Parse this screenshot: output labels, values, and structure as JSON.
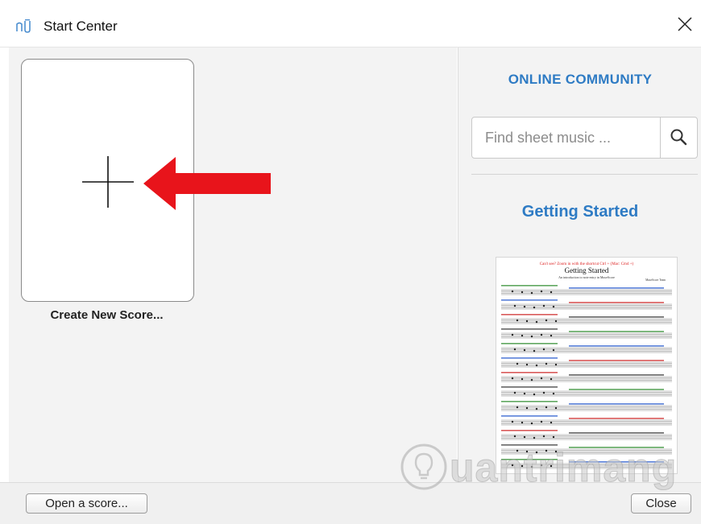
{
  "window": {
    "title": "Start Center"
  },
  "left": {
    "new_score_label": "Create New Score..."
  },
  "right": {
    "community_title": "ONLINE COMMUNITY",
    "search_placeholder": "Find sheet music ...",
    "getting_started_title": "Getting Started",
    "thumbnail": {
      "heading_line": "Can't see? Zoom in with the shortcut Ctrl + (Mac: Cmd +)",
      "title": "Getting Started",
      "subtitle": "An introduction to note entry in MuseScore",
      "author": "MuseScore Team"
    }
  },
  "footer": {
    "open_label": "Open a score...",
    "close_label": "Close"
  },
  "watermark": {
    "text": "uantrimang"
  },
  "colors": {
    "accent": "#2e7bc4",
    "arrow": "#e8141b",
    "pane_bg": "#f3f3f3"
  },
  "icons": {
    "app": "musescore-icon",
    "close": "close-icon",
    "plus": "plus-icon",
    "search": "search-icon",
    "arrow": "red-arrow"
  }
}
